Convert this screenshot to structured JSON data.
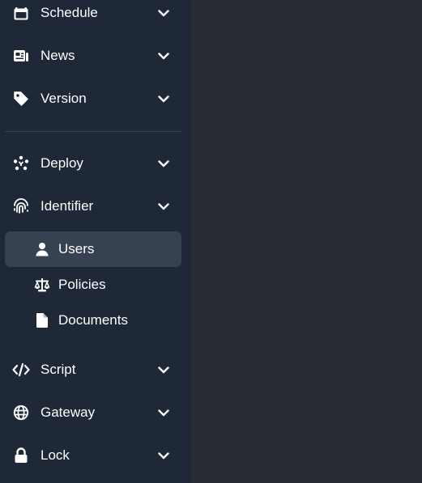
{
  "sidebar": {
    "items_top": [
      {
        "label": "Schedule",
        "icon": "calendar-icon"
      },
      {
        "label": "News",
        "icon": "newspaper-icon"
      },
      {
        "label": "Version",
        "icon": "tag-icon"
      }
    ],
    "items_mid": [
      {
        "label": "Deploy",
        "icon": "deploy-icon"
      },
      {
        "label": "Identifier",
        "icon": "fingerprint-icon"
      }
    ],
    "sub_items": [
      {
        "label": "Users",
        "icon": "user-icon",
        "active": true
      },
      {
        "label": "Policies",
        "icon": "scale-icon",
        "active": false
      },
      {
        "label": "Documents",
        "icon": "document-icon",
        "active": false
      }
    ],
    "items_bottom": [
      {
        "label": "Script",
        "icon": "code-icon"
      },
      {
        "label": "Gateway",
        "icon": "globe-icon"
      },
      {
        "label": "Lock",
        "icon": "lock-icon"
      }
    ]
  },
  "colors": {
    "sidebar_bg": "#1e2837",
    "main_bg": "#282c35",
    "active_bg": "#364152",
    "text": "#ffffff"
  }
}
